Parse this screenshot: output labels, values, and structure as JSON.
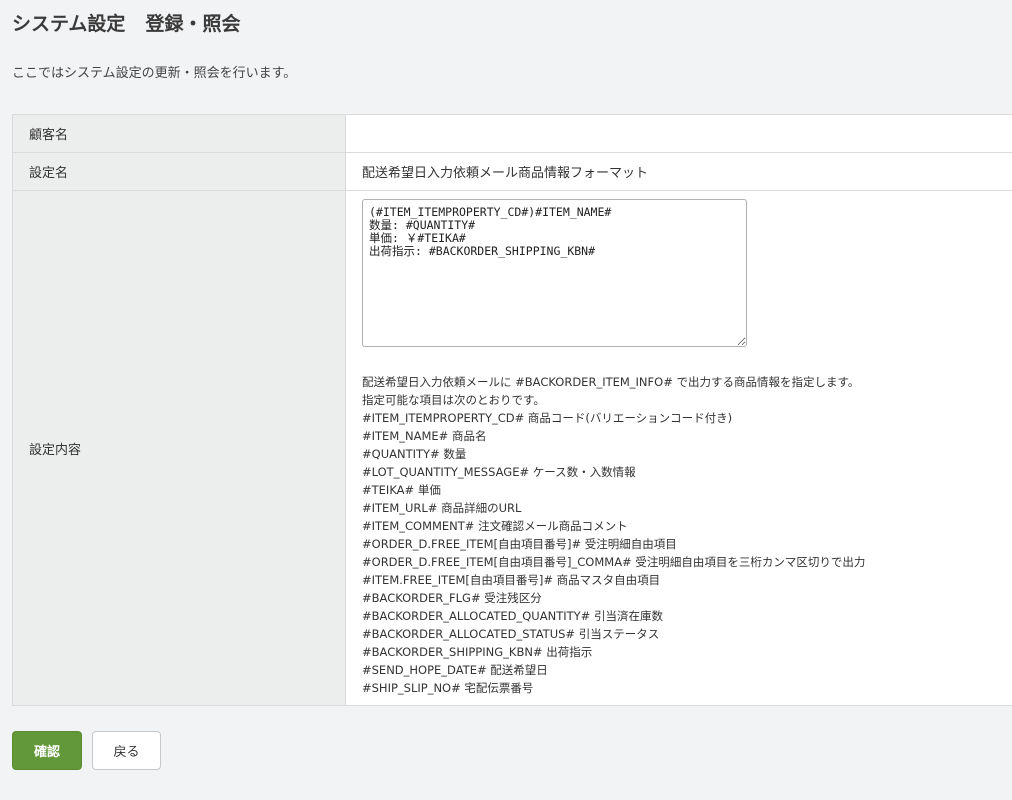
{
  "header": {
    "title_main": "システム設定",
    "title_sub": "登録・照会",
    "description": "ここではシステム設定の更新・照会を行います。"
  },
  "table": {
    "customer_label": "顧客名",
    "customer_value": "",
    "setting_name_label": "設定名",
    "setting_name_value": "配送希望日入力依頼メール商品情報フォーマット",
    "setting_content_label": "設定内容",
    "template_value": "(#ITEM_ITEMPROPERTY_CD#)#ITEM_NAME#\n数量: #QUANTITY#\n単価: ￥#TEIKA#\n出荷指示: #BACKORDER_SHIPPING_KBN#",
    "help_lines": [
      "配送希望日入力依頼メールに #BACKORDER_ITEM_INFO# で出力する商品情報を指定します。",
      "指定可能な項目は次のとおりです。",
      "#ITEM_ITEMPROPERTY_CD# 商品コード(バリエーションコード付き)",
      "#ITEM_NAME# 商品名",
      "#QUANTITY# 数量",
      "#LOT_QUANTITY_MESSAGE# ケース数・入数情報",
      "#TEIKA# 単価",
      "#ITEM_URL# 商品詳細のURL",
      "#ITEM_COMMENT# 注文確認メール商品コメント",
      "#ORDER_D.FREE_ITEM[自由項目番号]# 受注明細自由項目",
      "#ORDER_D.FREE_ITEM[自由項目番号]_COMMA# 受注明細自由項目を三桁カンマ区切りで出力",
      "#ITEM.FREE_ITEM[自由項目番号]# 商品マスタ自由項目",
      "#BACKORDER_FLG# 受注残区分",
      "#BACKORDER_ALLOCATED_QUANTITY# 引当済在庫数",
      "#BACKORDER_ALLOCATED_STATUS# 引当ステータス",
      "#BACKORDER_SHIPPING_KBN# 出荷指示",
      "#SEND_HOPE_DATE# 配送希望日",
      "#SHIP_SLIP_NO# 宅配伝票番号"
    ]
  },
  "actions": {
    "confirm_label": "確認",
    "back_label": "戻る"
  },
  "colors": {
    "confirm_button": "#62973a",
    "label_background": "#eceded",
    "page_background": "#f2f3f4"
  }
}
